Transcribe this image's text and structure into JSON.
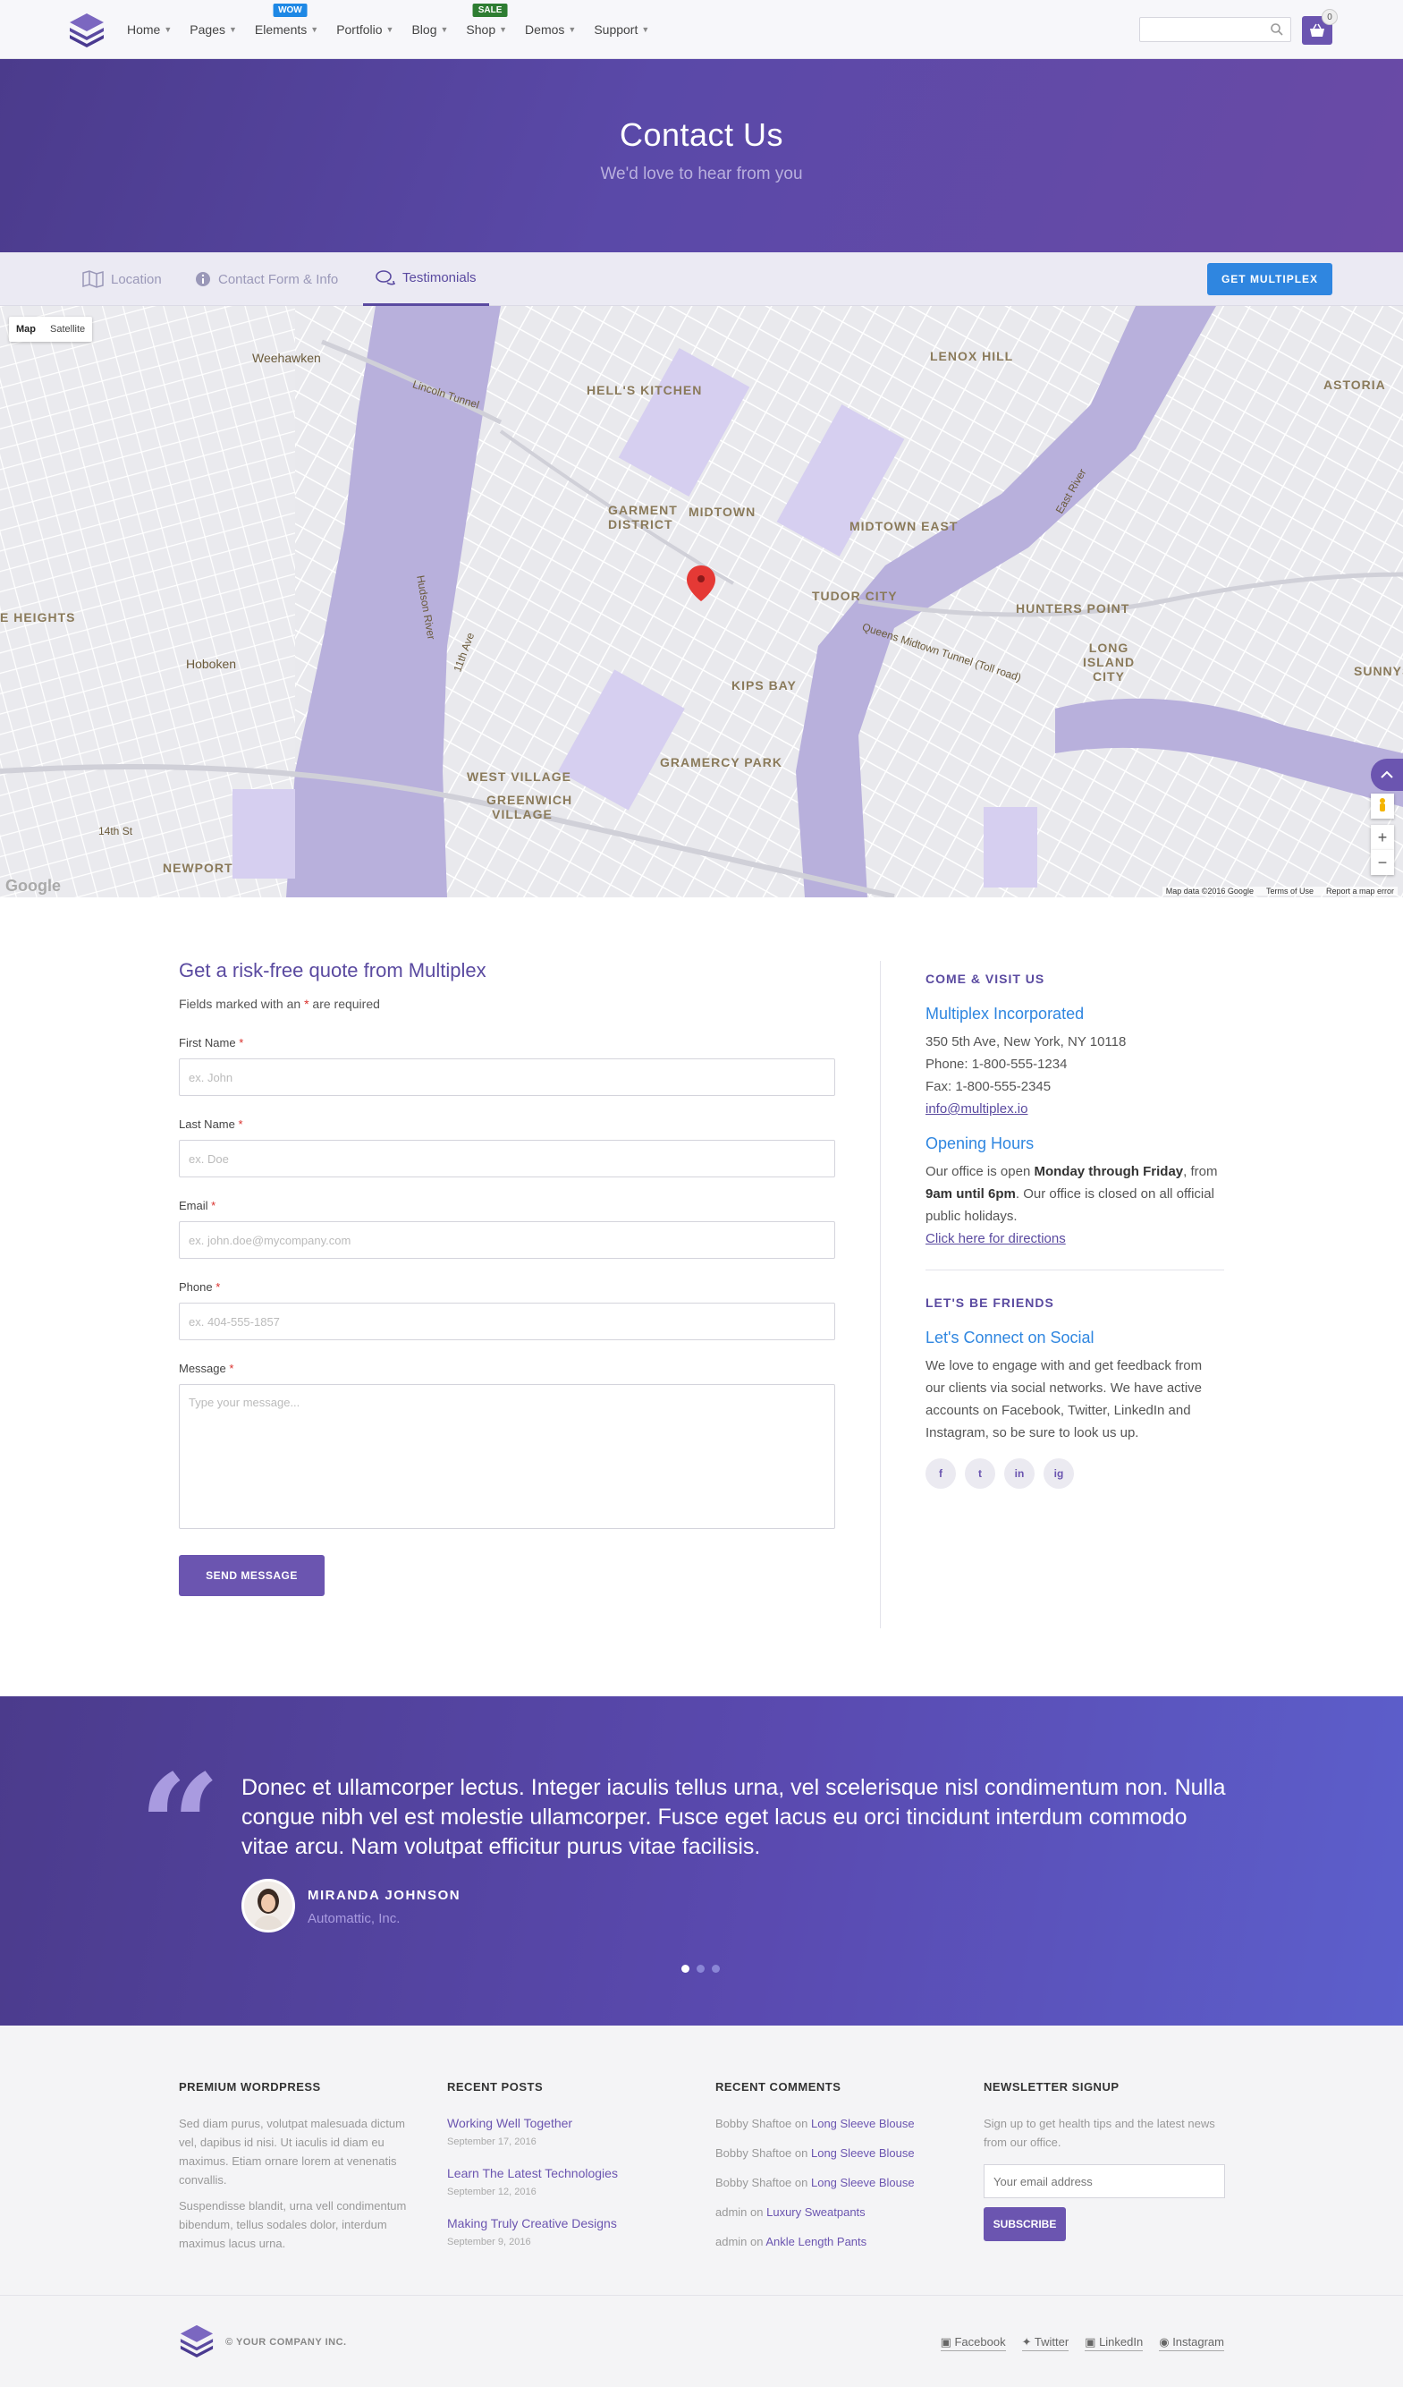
{
  "nav": {
    "items": [
      {
        "label": "Home"
      },
      {
        "label": "Pages"
      },
      {
        "label": "Elements",
        "badge": "WOW"
      },
      {
        "label": "Portfolio"
      },
      {
        "label": "Blog"
      },
      {
        "label": "Shop",
        "badge": "SALE"
      },
      {
        "label": "Demos"
      },
      {
        "label": "Support"
      }
    ],
    "cart_count": "0"
  },
  "hero": {
    "title": "Contact Us",
    "subtitle": "We'd love to hear from you"
  },
  "tabs": [
    {
      "label": "Location",
      "icon": "map-icon"
    },
    {
      "label": "Contact Form & Info",
      "icon": "info-icon"
    },
    {
      "label": "Testimonials",
      "icon": "chat-icon",
      "active": true
    }
  ],
  "get_button": "GET MULTIPLEX",
  "map": {
    "type_map": "Map",
    "type_satellite": "Satellite",
    "labels": [
      "Weehawken",
      "HELL'S KITCHEN",
      "LENOX HILL",
      "ASTORIA",
      "GARMENT DISTRICT",
      "MIDTOWN",
      "MIDTOWN EAST",
      "TUDOR CITY",
      "HUNTERS POINT",
      "LONG ISLAND CITY",
      "KIPS BAY",
      "Hoboken",
      "GRAMERCY PARK",
      "WEST VILLAGE",
      "GREENWICH VILLAGE",
      "NEWPORT",
      "SUNNYS",
      "E HEIGHTS"
    ],
    "small_labels": [
      "Lincoln Tunnel",
      "Queens Midtown Tunnel (Toll road)",
      "Hudson River",
      "East River",
      "11th Ave",
      "14th St"
    ],
    "footer": [
      "Map data ©2016 Google",
      "Terms of Use",
      "Report a map error"
    ],
    "google": "Google"
  },
  "form": {
    "title": "Get a risk-free quote from Multiplex",
    "note_before": "Fields marked with an ",
    "note_star": "*",
    "note_after": " are required",
    "fields": [
      {
        "label": "First Name",
        "placeholder": "ex. John"
      },
      {
        "label": "Last Name",
        "placeholder": "ex. Doe"
      },
      {
        "label": "Email",
        "placeholder": "ex. john.doe@mycompany.com"
      },
      {
        "label": "Phone",
        "placeholder": "ex. 404-555-1857"
      }
    ],
    "message_label": "Message",
    "message_placeholder": "Type your message...",
    "required_star": "*",
    "send_label": "SEND MESSAGE"
  },
  "info": {
    "visit_head": "COME & VISIT US",
    "company": "Multiplex Incorporated",
    "address": "350 5th Ave, New York, NY 10118",
    "phone": "Phone: 1-800-555-1234",
    "fax": "Fax: 1-800-555-2345",
    "email": "info@multiplex.io",
    "hours_title": "Opening Hours",
    "hours_1": "Our office is open ",
    "hours_days": "Monday through Friday",
    "hours_2": ", from ",
    "hours_time": "9am until 6pm",
    "hours_3": ". Our office is closed on all official public holidays.",
    "directions": "Click here for directions",
    "friends_head": "LET'S BE FRIENDS",
    "social_title": "Let's Connect on Social",
    "social_text": "We love to engage with and get feedback from our clients via social networks. We have active accounts on Facebook, Twitter, LinkedIn and Instagram, so be sure to look us up.",
    "socials": [
      "f",
      "t",
      "in",
      "ig"
    ]
  },
  "testimonial": {
    "quote": "Donec et ullamcorper lectus. Integer iaculis tellus urna, vel scelerisque nisl condimentum non. Nulla congue nibh vel est molestie ullamcorper. Fusce eget lacus eu orci tincidunt interdum commodo vitae arcu. Nam volutpat efficitur purus vitae facilisis.",
    "author": "MIRANDA JOHNSON",
    "company": "Automattic, Inc."
  },
  "footer": {
    "col1": {
      "head": "PREMIUM WORDPRESS",
      "p1": "Sed diam purus, volutpat malesuada dictum vel, dapibus id nisi. Ut iaculis id diam eu maximus. Etiam ornare lorem at venenatis convallis.",
      "p2": "Suspendisse blandit, urna vell condimentum bibendum, tellus sodales dolor, interdum maximus lacus urna."
    },
    "col2": {
      "head": "RECENT POSTS",
      "posts": [
        {
          "title": "Working Well Together",
          "date": "September 17, 2016"
        },
        {
          "title": "Learn The Latest Technologies",
          "date": "September 12, 2016"
        },
        {
          "title": "Making Truly Creative Designs",
          "date": "September 9, 2016"
        }
      ]
    },
    "col3": {
      "head": "RECENT COMMENTS",
      "comments": [
        {
          "author": "Bobby Shaftoe",
          "on": " on ",
          "post": "Long Sleeve Blouse"
        },
        {
          "author": "Bobby Shaftoe",
          "on": " on ",
          "post": "Long Sleeve Blouse"
        },
        {
          "author": "Bobby Shaftoe",
          "on": " on ",
          "post": "Long Sleeve Blouse"
        },
        {
          "author": "admin",
          "on": " on ",
          "post": "Luxury Sweatpants"
        },
        {
          "author": "admin",
          "on": " on ",
          "post": "Ankle Length Pants"
        }
      ]
    },
    "col4": {
      "head": "NEWSLETTER SIGNUP",
      "text": "Sign up to get health tips and the latest news from our office.",
      "placeholder": "Your email address",
      "button": "SUBSCRIBE"
    }
  },
  "bottom": {
    "copyright": "© YOUR COMPANY INC.",
    "links": [
      "Facebook",
      "Twitter",
      "LinkedIn",
      "Instagram"
    ]
  },
  "colors": {
    "brand": "#6b55b0",
    "accent_blue": "#2f86e0",
    "required": "#d9302c"
  }
}
